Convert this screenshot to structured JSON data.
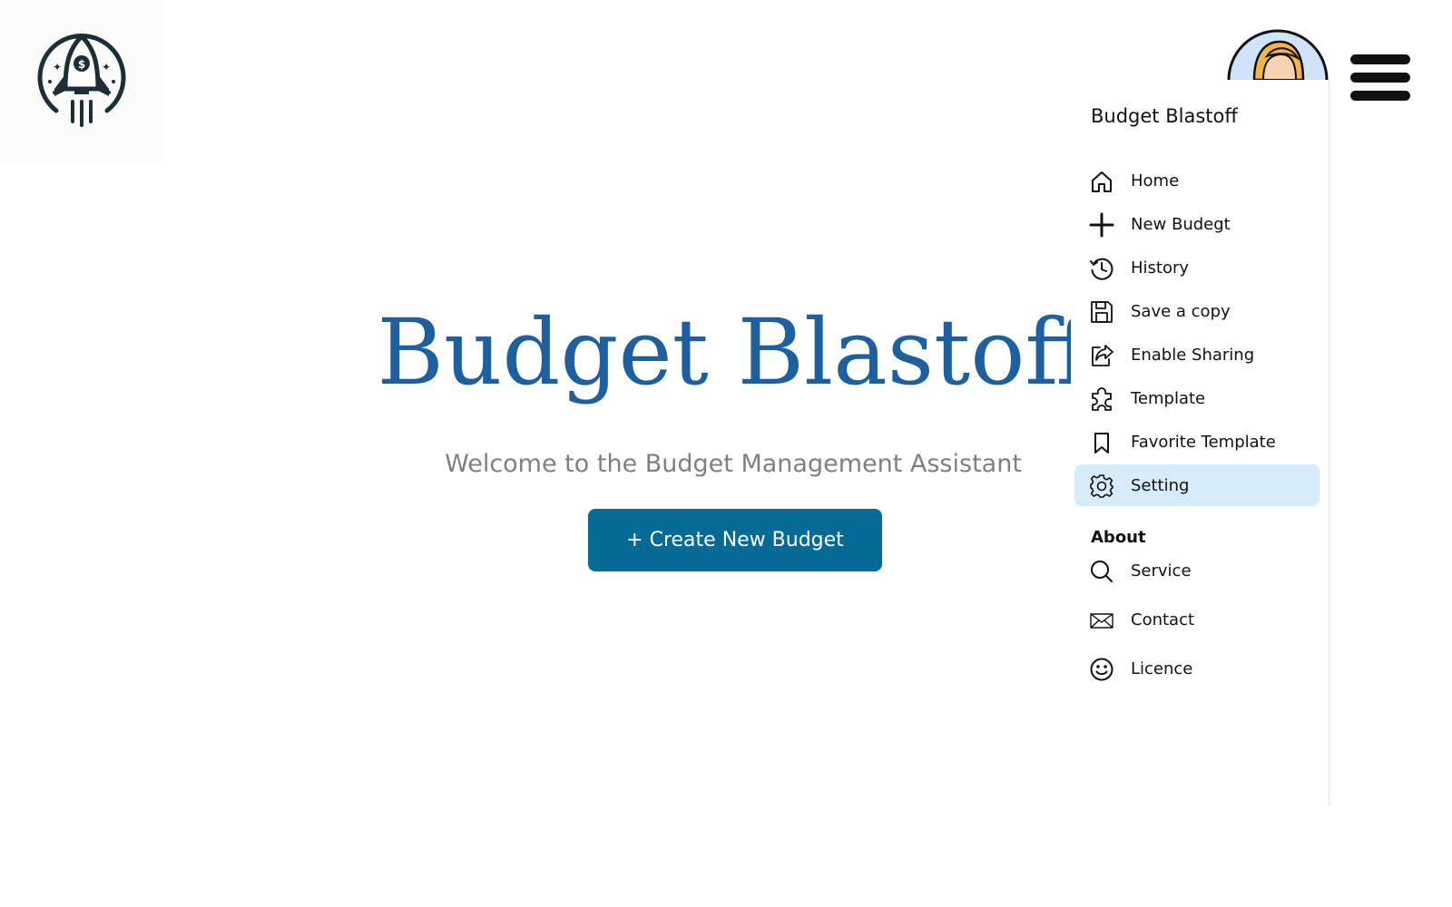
{
  "app": {
    "logo_icon": "rocket-dollar-logo-icon"
  },
  "hero": {
    "title": "Budget Blastoff",
    "subtitle": "Welcome to the Budget Management Assistant",
    "cta_label": "+ Create New Budget"
  },
  "header": {
    "avatar_icon": "user-avatar-icon",
    "menu_icon": "hamburger-menu-icon"
  },
  "drawer": {
    "title": "Budget Blastoff",
    "items": [
      {
        "label": "Home",
        "icon": "home-icon"
      },
      {
        "label": "New Budegt",
        "icon": "plus-icon"
      },
      {
        "label": "History",
        "icon": "history-icon"
      },
      {
        "label": "Save a copy",
        "icon": "save-icon"
      },
      {
        "label": "Enable Sharing",
        "icon": "share-icon"
      },
      {
        "label": "Template",
        "icon": "puzzle-icon"
      },
      {
        "label": "Favorite Template",
        "icon": "bookmark-icon"
      },
      {
        "label": "Setting",
        "icon": "gear-icon",
        "active": true
      }
    ],
    "about_label": "About",
    "about_items": [
      {
        "label": "Service",
        "icon": "search-icon"
      },
      {
        "label": "Contact",
        "icon": "mail-icon"
      },
      {
        "label": "Licence",
        "icon": "smile-icon"
      }
    ]
  },
  "colors": {
    "title_blue": "#1e5fa0",
    "button_blue": "#056a94",
    "active_bg": "#d6ecfb"
  }
}
